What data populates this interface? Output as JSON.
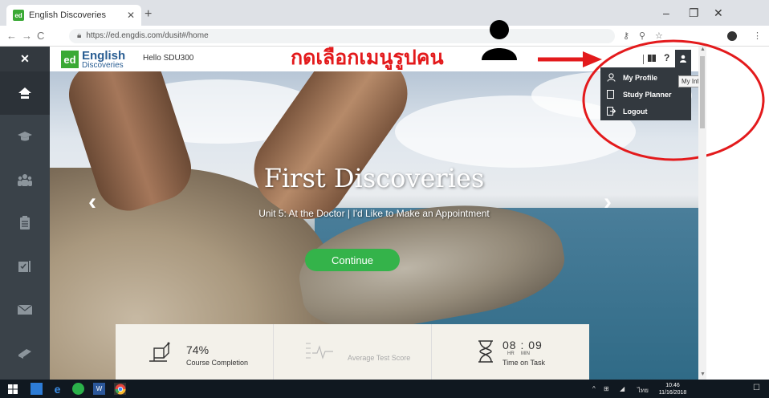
{
  "browser": {
    "tab_title": "English Discoveries",
    "favicon_text": "ed",
    "url": "https://ed.engdis.com/dusit#/home",
    "window_buttons": [
      "–",
      "❐",
      "✕"
    ]
  },
  "header": {
    "close_label": "✕",
    "logo_mark": "ed",
    "logo_line1": "English",
    "logo_line2": "Discoveries",
    "greeting": "Hello SDU300",
    "help_label": "?"
  },
  "annotation": {
    "instruction": "กดเลือกเมนูรูปคน",
    "color": "#e31a1c"
  },
  "user_menu": {
    "items": [
      {
        "label": "My Profile",
        "icon": "person-outline-icon"
      },
      {
        "label": "Study Planner",
        "icon": "document-icon"
      },
      {
        "label": "Logout",
        "icon": "logout-icon"
      }
    ],
    "tooltip": "My Info"
  },
  "sidebar": {
    "items": [
      {
        "icon": "home-icon",
        "active": true
      },
      {
        "icon": "graduation-cap-icon",
        "active": false
      },
      {
        "icon": "community-icon",
        "active": false
      },
      {
        "icon": "clipboard-icon",
        "active": false
      },
      {
        "icon": "assignments-icon",
        "active": false
      },
      {
        "icon": "mail-icon",
        "active": false
      },
      {
        "icon": "dictionary-icon",
        "active": false
      }
    ]
  },
  "hero": {
    "title": "First Discoveries",
    "subtitle": "Unit 5: At the Doctor | I'd Like to Make an Appointment",
    "cta_label": "Continue",
    "prev_arrow": "‹",
    "next_arrow": "›"
  },
  "stats": {
    "completion_value": "74%",
    "completion_label": "Course Completion",
    "test_score_label": "Average Test Score",
    "time_value": "08 : 09",
    "time_hr": "HR",
    "time_min": "MIN",
    "time_label": "Time on Task"
  },
  "taskbar": {
    "time": "10:46",
    "date": "11/16/2018",
    "lang": "ไทย"
  },
  "colors": {
    "brand_green": "#3aa935",
    "sidebar": "#3a4249",
    "button_green": "#34b34a",
    "annotation_red": "#e31a1c"
  }
}
